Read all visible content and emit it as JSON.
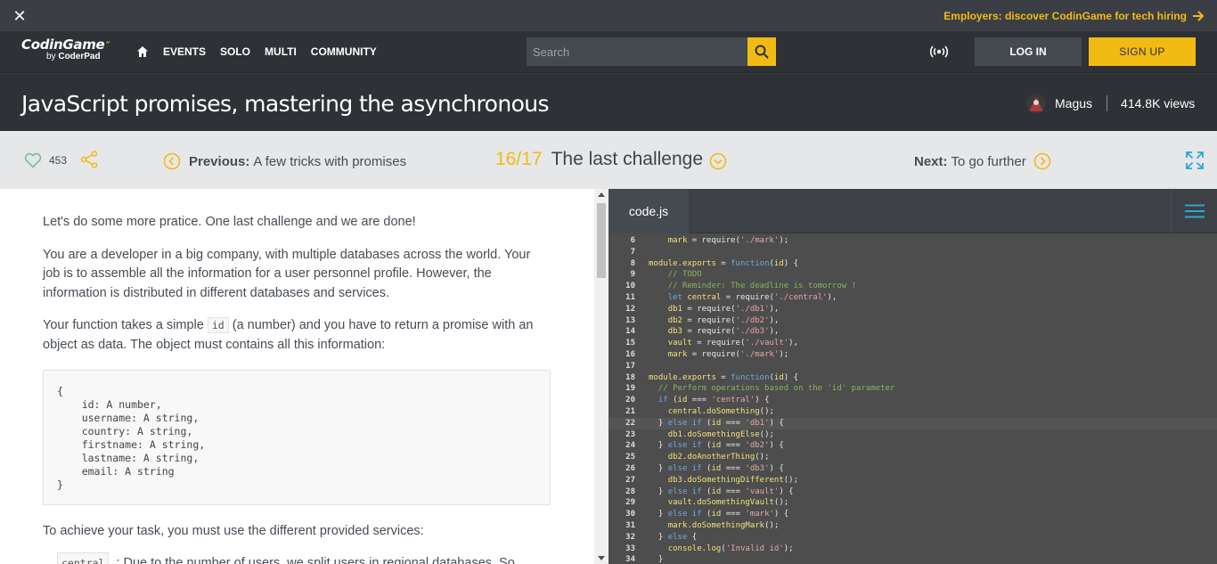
{
  "promo": {
    "close_icon": "close-icon",
    "link_text": "Employers: discover CodinGame for tech hiring",
    "accent": "#f2bb13"
  },
  "nav": {
    "logo_main": "CodinGame",
    "logo_by": "by",
    "logo_sub": "CoderPad",
    "items": [
      "EVENTS",
      "SOLO",
      "MULTI",
      "COMMUNITY"
    ],
    "search_placeholder": "Search",
    "login": "LOG IN",
    "signup": "SIGN UP"
  },
  "header": {
    "title": "JavaScript promises, mastering the asynchronous",
    "author": "Magus",
    "views": "414.8K views"
  },
  "chapter": {
    "likes": "453",
    "prev_label": "Previous:",
    "prev_title": "A few tricks with promises",
    "current_num": "16/17",
    "current_title": "The last challenge",
    "next_label": "Next:",
    "next_title": "To go further"
  },
  "article": {
    "p1": "Let's do some more pratice. One last challenge and we are done!",
    "p2": "You are a developer in a big company, with multiple databases across the world. Your job is to assemble all the information for a user personnel profile. However, the information is distributed in different databases and services.",
    "p3a": "Your function takes a simple ",
    "p3code": "id",
    "p3b": " (a number) and you have to return a promise with an object as data. The object must contains all this information:",
    "codeblock": "{\n    id: A number,\n    username: A string,\n    country: A string,\n    firstname: A string,\n    lastname: A string,\n    email: A string\n}",
    "p4": "To achieve your task, you must use the different provided services:",
    "p5_code": "central",
    "p5_text": ": Due to the number of users, we split users in regional databases. So"
  },
  "editor": {
    "tab": "code.js",
    "menu_icon": "hamburger-menu-icon"
  }
}
